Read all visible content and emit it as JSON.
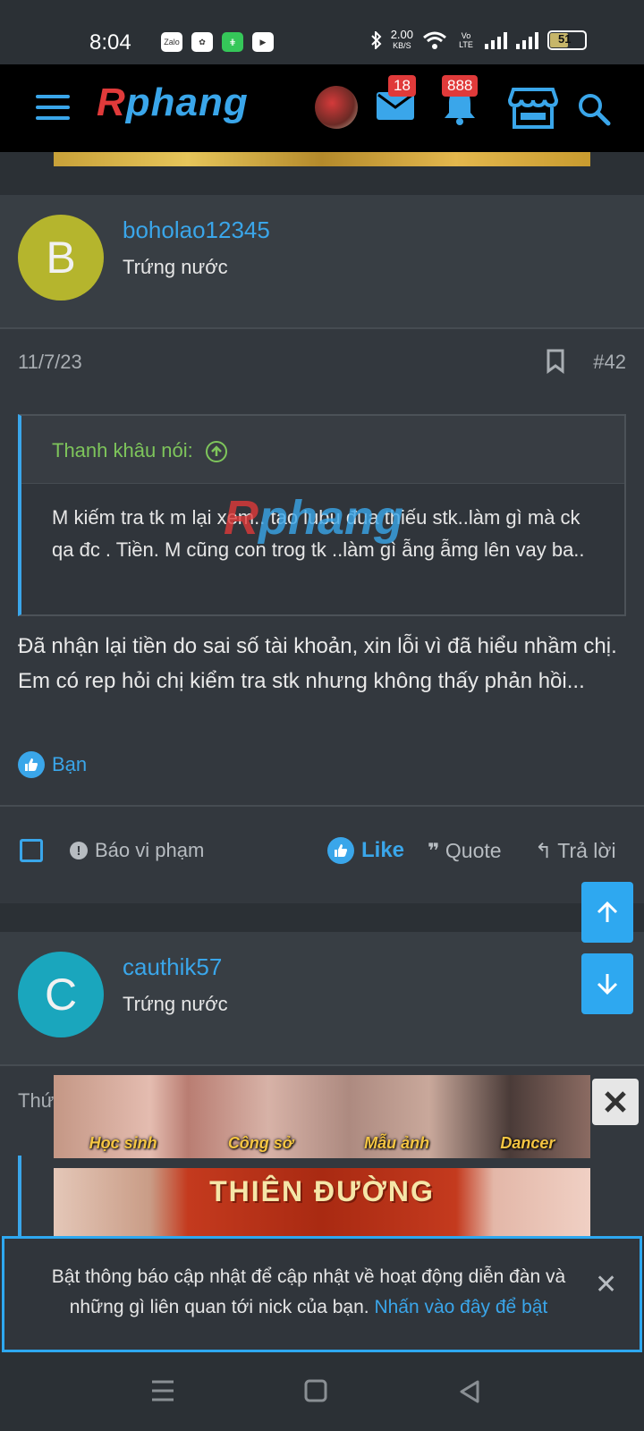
{
  "status_bar": {
    "time": "8:04",
    "apps": [
      "Zalo",
      "✿",
      "⋕",
      "▶"
    ],
    "net_speed": "2.00",
    "net_unit": "KB/S",
    "volte": "Vo LTE",
    "battery": "51"
  },
  "header": {
    "logo_first": "R",
    "logo_rest": "phang",
    "messages_count": "18",
    "alerts_count": "888"
  },
  "posts": [
    {
      "avatar_letter": "B",
      "avatar_color": "#b5b52d",
      "username": "boholao12345",
      "user_title": "Trứng nước",
      "date": "11/7/23",
      "post_number": "#42",
      "quote_author": "Thanh khâu nói:",
      "quote_text": "M kiếm tra tk m lại xem.. tao lubu đua thiếu stk..làm gì mà ck qa đc . Tiền. M cũng con trog tk ..làm gì ẫng ẫmg lên vay ba..",
      "body": "Đã nhận lại tiền do sai số tài khoản, xin lỗi vì đã hiểu nhầm chị. Em có rep hỏi chị kiểm tra stk nhưng không thấy phản hồi...",
      "reaction_by": "Bạn",
      "actions": {
        "report": "Báo vi phạm",
        "like": "Like",
        "quote": "Quote",
        "reply": "Trả lời"
      }
    },
    {
      "avatar_letter": "C",
      "avatar_color": "#1aa6bd",
      "username": "cauthik57",
      "user_title": "Trứng nước",
      "date_partial": "Thứ"
    }
  ],
  "watermark": {
    "first": "R",
    "rest": "phang"
  },
  "ads": {
    "banner1_labels": [
      "Học sinh",
      "Công sở",
      "Mẫu ảnh",
      "Dancer"
    ],
    "banner2_title": "THIÊN ĐƯỜNG"
  },
  "notification": {
    "text": "Bật thông báo cập nhật để cập nhật về hoạt động diễn đàn và những gì liên quan tới nick của bạn.",
    "link": "Nhấn vào đây để bật"
  }
}
